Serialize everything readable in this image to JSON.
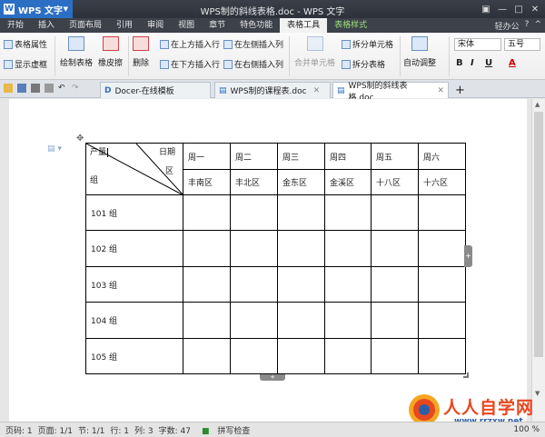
{
  "app": {
    "menu_label": "WPS 文字",
    "window_title": "WPS制的斜线表格.doc - WPS 文字",
    "user": "轻办公"
  },
  "menu_tabs": [
    "开始",
    "插入",
    "页面布局",
    "引用",
    "审阅",
    "视图",
    "章节",
    "特色功能",
    "表格工具",
    "表格样式"
  ],
  "ribbon": {
    "table_props": "表格属性",
    "show_gridlines": "显示虚框",
    "draw_table": "绘制表格",
    "eraser": "橡皮擦",
    "delete": "删除",
    "insert_above": "在上方插入行",
    "insert_below": "在下方插入行",
    "insert_left": "在左侧插入列",
    "insert_right": "在右侧插入列",
    "merge_cells": "合并单元格",
    "split_cells": "拆分单元格",
    "split_table": "拆分表格",
    "auto_fit": "自动调整",
    "font_name": "宋体",
    "font_size": "五号",
    "bold": "B",
    "italic": "I",
    "underline": "U",
    "font_color": "A"
  },
  "doc_tabs": [
    {
      "label": "Docer-在线模板"
    },
    {
      "label": "WPS制的课程表.doc"
    },
    {
      "label": "WPS制的斜线表格.doc"
    }
  ],
  "table": {
    "diag_labels": {
      "top_right": "日期",
      "middle_right": "区",
      "top_left": "产量",
      "bottom_left": "组"
    },
    "days": [
      "周一",
      "周二",
      "周三",
      "周四",
      "周五",
      "周六"
    ],
    "districts": [
      "丰南区",
      "丰北区",
      "金东区",
      "金溪区",
      "十八区",
      "十六区"
    ],
    "rows": [
      "101 组",
      "102 组",
      "103 组",
      "104 组",
      "105 组"
    ]
  },
  "watermark": {
    "text": "人人自学网",
    "url": "www.rrzxw.net"
  },
  "status": {
    "page_num": "页码: 1",
    "pages": "页面: 1/1",
    "section": "节: 1/1",
    "row": "行: 1",
    "column": "列: 3",
    "words": "字数: 47",
    "spell": "拼写检查",
    "zoom": "100 %"
  }
}
